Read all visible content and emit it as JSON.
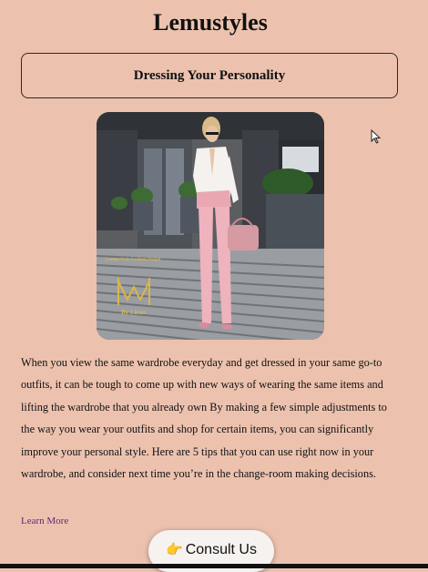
{
  "site": {
    "title": "Lemustyles"
  },
  "section": {
    "heading": "Dressing Your Personality"
  },
  "photo": {
    "watermark_text": "Leemu Style Fashion Design",
    "watermark_by": "By Liron"
  },
  "article": {
    "paragraph": "When you view the same wardrobe everyday and get dressed in your same go-to outfits, it can be tough to come up with new ways of wearing the same items and lifting the wardrobe that you already own By making a few simple adjustments to the way you wear your outfits and shop for certain items, you can significantly improve your personal style. Here are 5 tips that you can use right now in your wardrobe, and consider next time you’re in the change-room making decisions.",
    "learn_more": "Learn More"
  },
  "cta": {
    "consult_label": "Consult Us",
    "icon": "pointing-hand-icon"
  },
  "colors": {
    "background": "#ecc2af",
    "link": "#5c2a7a",
    "button_bg": "#f6f2ef"
  }
}
